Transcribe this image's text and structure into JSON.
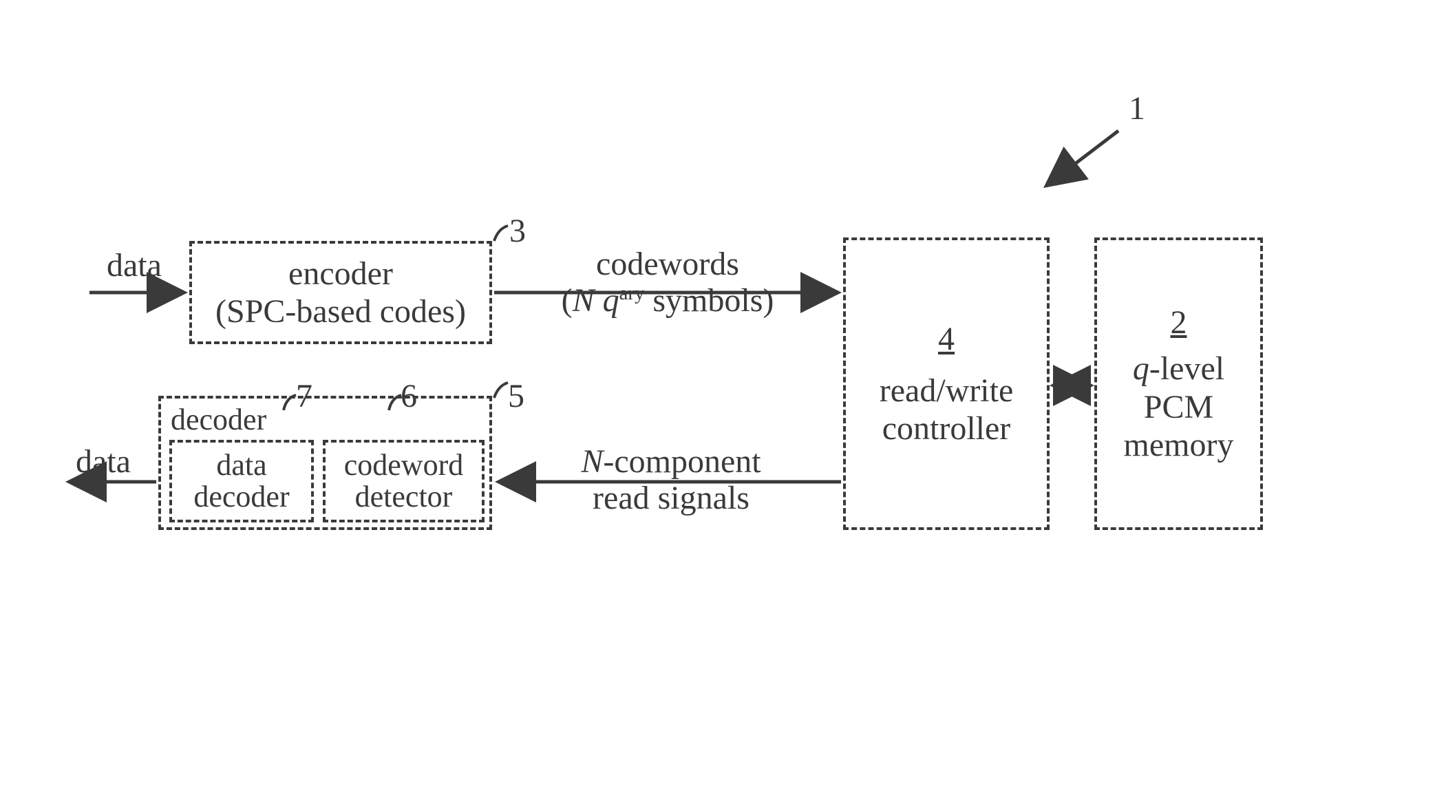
{
  "refs": {
    "system": "1",
    "memory": "2",
    "encoder": "3",
    "controller": "4",
    "decoder": "5",
    "detector": "6",
    "data_decoder": "7"
  },
  "labels": {
    "data_in": "data",
    "data_out": "data",
    "codewords_line1": "codewords",
    "codewords_line2_prefix": "(",
    "codewords_line2_N": "N",
    "codewords_line2_space": " ",
    "codewords_line2_q": "q",
    "codewords_line2_sup": "ary",
    "codewords_line2_suffix": " symbols)",
    "read_line1_prefix": "",
    "read_line1_N": "N",
    "read_line1_suffix": "-component",
    "read_line2": "read signals"
  },
  "blocks": {
    "encoder_line1": "encoder",
    "encoder_line2": "(SPC-based codes)",
    "controller_num": "4",
    "controller_text": "read/write\ncontroller",
    "memory_num": "2",
    "memory_line1_q": "q",
    "memory_line1_suffix": "-level",
    "memory_line2": "PCM",
    "memory_line3": "memory",
    "decoder_title": "decoder",
    "data_decoder": "data\ndecoder",
    "codeword_detector": "codeword\ndetector"
  }
}
